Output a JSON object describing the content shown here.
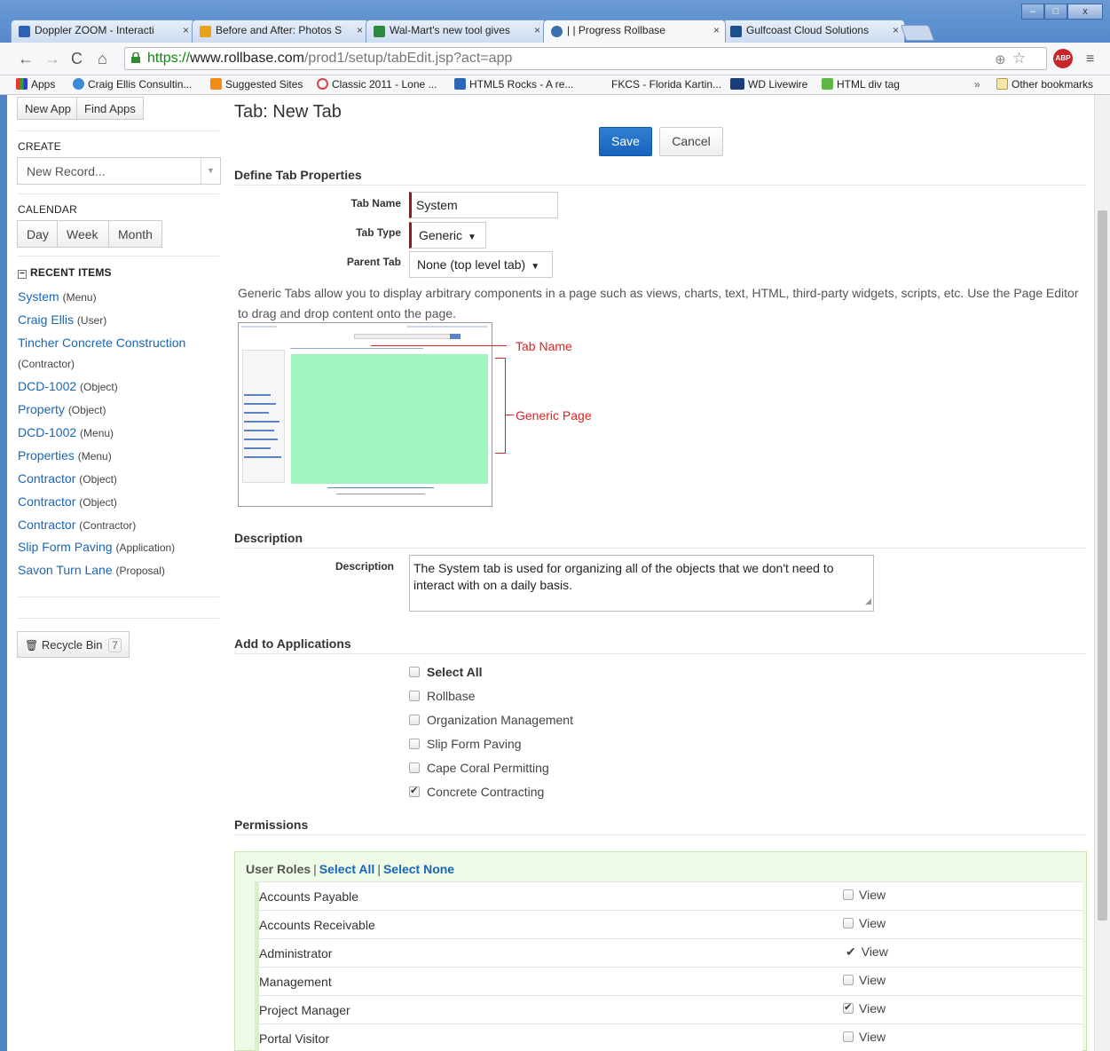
{
  "browser": {
    "tabs": [
      {
        "title": "Doppler ZOOM - Interacti",
        "fav": "#2b63b5"
      },
      {
        "title": "Before and After: Photos S",
        "fav": "#e8a21b"
      },
      {
        "title": "Wal-Mart's new tool gives",
        "fav": "#2c8a3c"
      },
      {
        "title": "| | Progress Rollbase",
        "fav": "#3a6fb0"
      },
      {
        "title": "Gulfcoast Cloud Solutions",
        "fav": "#1d4f8f"
      }
    ],
    "url_https": "https://",
    "url_host": "www.rollbase.com",
    "url_rest": "/prod1/setup/tabEdit.jsp?act=app",
    "bookmarks": [
      "Apps",
      "Craig Ellis Consultin...",
      "Suggested Sites",
      "Classic 2011 - Lone ...",
      "HTML5 Rocks - A re...",
      "FKCS - Florida Kartin...",
      "WD Livewire",
      "HTML div tag",
      "»",
      "Other bookmarks"
    ],
    "colors": {
      "chrome": "#4f84c4",
      "accent": "#1a66b5"
    }
  },
  "sidebar": {
    "new_app": "New App",
    "find_apps": "Find Apps",
    "create_heading": "CREATE",
    "new_record": "New Record...",
    "calendar_heading": "CALENDAR",
    "calendar_buttons": [
      "Day",
      "Week",
      "Month"
    ],
    "recent_heading": "RECENT ITEMS",
    "recent_items": [
      {
        "name": "System",
        "kind": "(Menu)"
      },
      {
        "name": "Craig Ellis",
        "kind": "(User)"
      },
      {
        "name": "Tincher Concrete Construction",
        "kind": ""
      },
      {
        "name": "DCD-1002",
        "kind": "(Object)"
      },
      {
        "name": "Property",
        "kind": "(Object)"
      },
      {
        "name": "DCD-1002",
        "kind": "(Menu)"
      },
      {
        "name": "Properties",
        "kind": "(Menu)"
      },
      {
        "name": "Contractor",
        "kind": "(Object)"
      },
      {
        "name": "Contractor",
        "kind": "(Object)"
      },
      {
        "name": "Contractor",
        "kind": "(Contractor)"
      },
      {
        "name": "Slip Form Paving",
        "kind": "(Application)"
      },
      {
        "name": "Savon Turn Lane",
        "kind": "(Proposal)"
      }
    ],
    "tincher_kind": "(Contractor)",
    "recycle_bin": "Recycle Bin",
    "recycle_count": "7"
  },
  "main": {
    "title": "Tab: New Tab",
    "save": "Save",
    "cancel": "Cancel",
    "define_heading": "Define Tab Properties",
    "tab_name_label": "Tab Name",
    "tab_name_value": "System",
    "tab_type_label": "Tab Type",
    "tab_type_value": "Generic",
    "parent_tab_label": "Parent Tab",
    "parent_tab_value": "None (top level tab)",
    "generic_text": "Generic Tabs allow you to display arbitrary components in a page such as views, charts, text, HTML, third-party widgets, scripts, etc. Use the Page Editor to drag and drop content onto the page.",
    "annot_tab_name": "Tab Name",
    "annot_generic_page": "Generic Page",
    "description_heading": "Description",
    "description_label": "Description",
    "description_value": "The System tab is used for organizing all of the objects that we don't need to interact with on a daily basis.",
    "apps_heading": "Add to Applications",
    "apps": [
      {
        "label": "Select All",
        "checked": false,
        "bold": true
      },
      {
        "label": "Rollbase",
        "checked": false
      },
      {
        "label": "Organization Management",
        "checked": false
      },
      {
        "label": "Slip Form Paving",
        "checked": false
      },
      {
        "label": "Cape Coral Permitting",
        "checked": false
      },
      {
        "label": "Concrete Contracting",
        "checked": true
      }
    ],
    "permissions_heading": "Permissions",
    "user_roles_label": "User Roles",
    "select_all": "Select All",
    "select_none": "Select None",
    "roles": [
      {
        "name": "Accounts Payable",
        "view": "View",
        "checked": false
      },
      {
        "name": "Accounts Receivable",
        "view": "View",
        "checked": false
      },
      {
        "name": "Administrator",
        "view": "View",
        "checked": true,
        "plain_check": true
      },
      {
        "name": "Management",
        "view": "View",
        "checked": false
      },
      {
        "name": "Project Manager",
        "view": "View",
        "checked": true
      },
      {
        "name": "Portal Visitor",
        "view": "View",
        "checked": false
      }
    ]
  }
}
